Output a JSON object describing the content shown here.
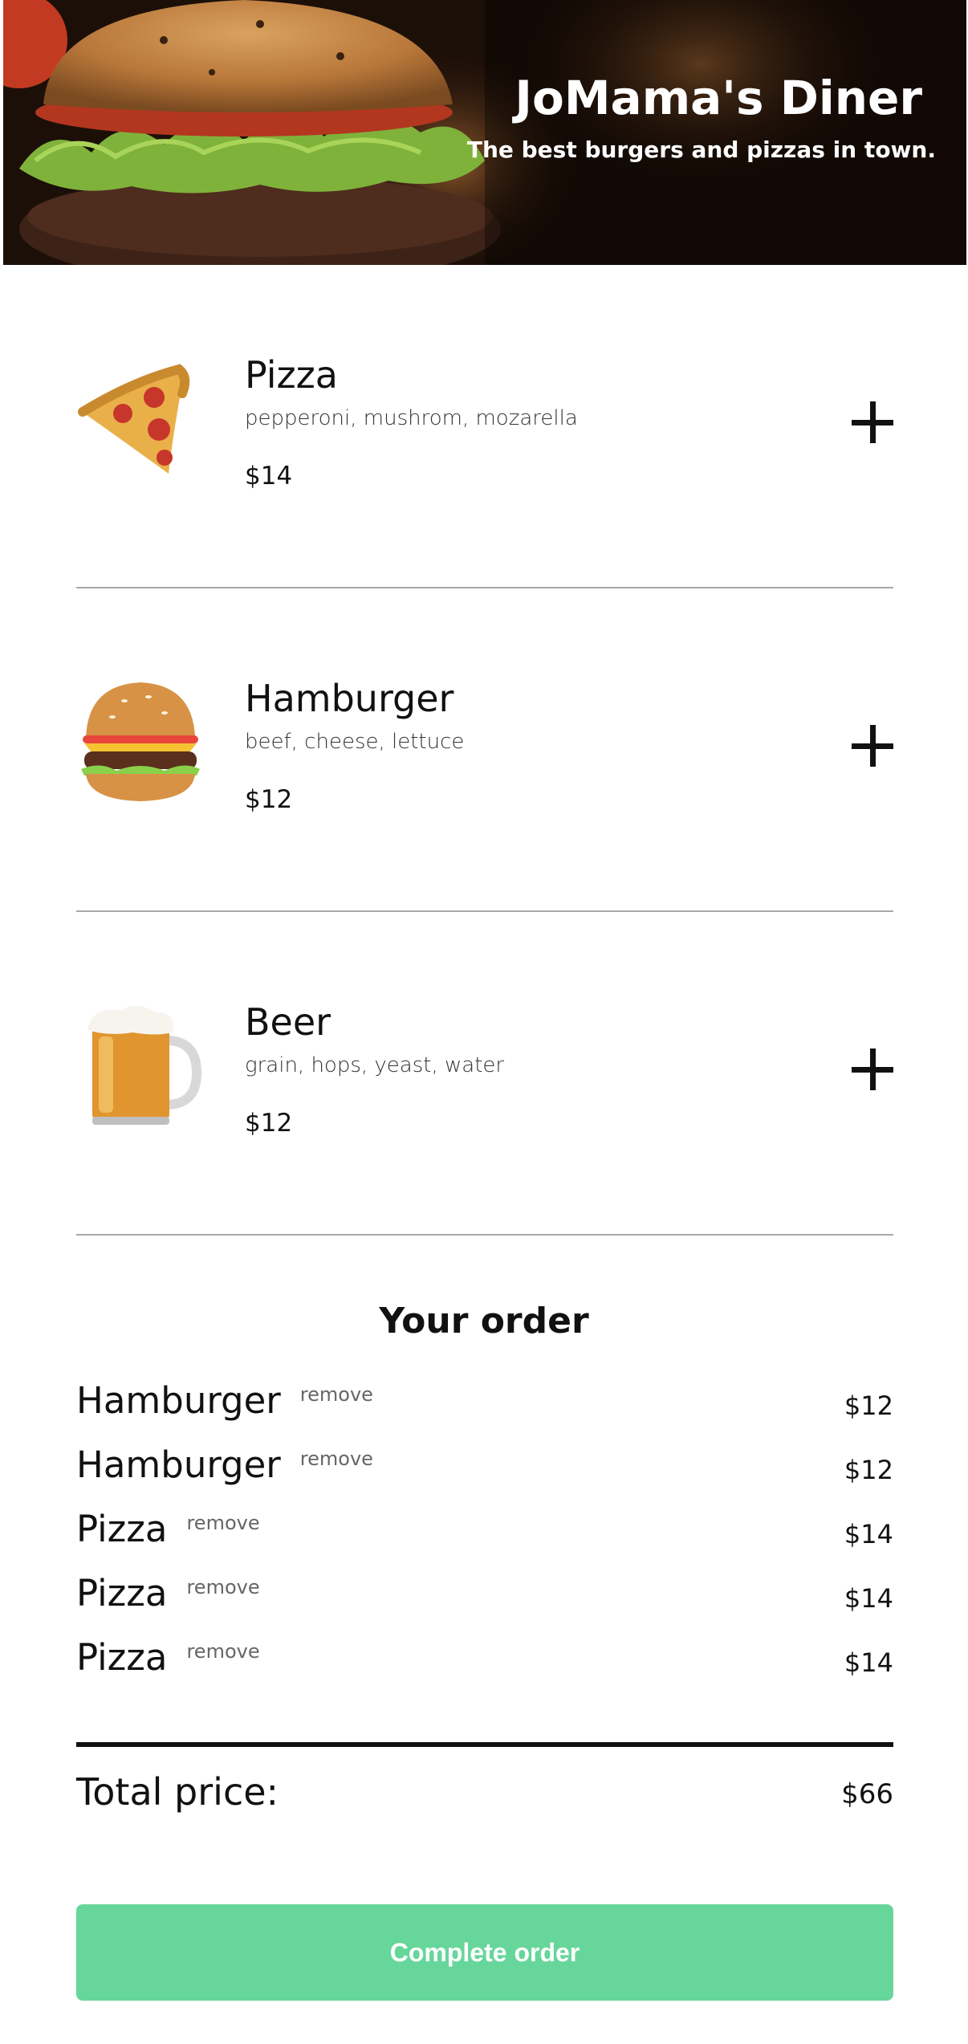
{
  "header": {
    "title": "JoMama's Diner",
    "subtitle": "The best burgers and pizzas in town."
  },
  "menu": {
    "items": [
      {
        "name": "Pizza",
        "description": "pepperoni, mushrom, mozarella",
        "price": "$14",
        "icon": "pizza-icon"
      },
      {
        "name": "Hamburger",
        "description": "beef, cheese, lettuce",
        "price": "$12",
        "icon": "hamburger-icon"
      },
      {
        "name": "Beer",
        "description": "grain, hops, yeast, water",
        "price": "$12",
        "icon": "beer-icon"
      }
    ],
    "add_icon": "plus-icon"
  },
  "order": {
    "title": "Your order",
    "remove_label": "remove",
    "items": [
      {
        "name": "Hamburger",
        "price": "$12"
      },
      {
        "name": "Hamburger",
        "price": "$12"
      },
      {
        "name": "Pizza",
        "price": "$14"
      },
      {
        "name": "Pizza",
        "price": "$14"
      },
      {
        "name": "Pizza",
        "price": "$14"
      }
    ],
    "total_label": "Total price:",
    "total_value": "$66"
  },
  "actions": {
    "complete_label": "Complete order"
  },
  "colors": {
    "accent_button": "#67d69b",
    "divider": "#a8a8a8"
  }
}
